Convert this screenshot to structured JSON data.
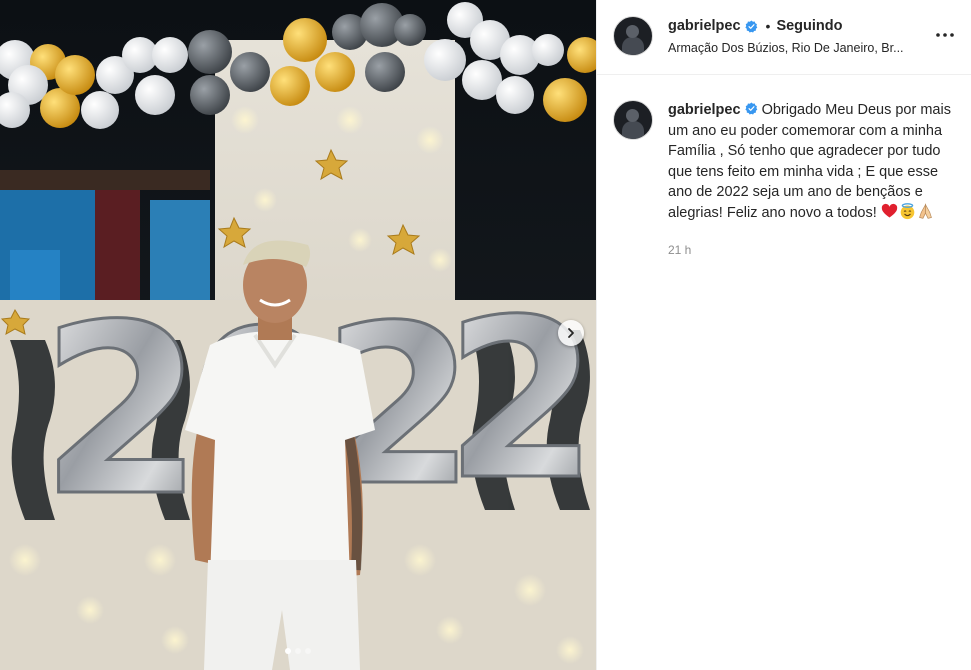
{
  "post": {
    "username": "gabrielpec",
    "follow_separator": "•",
    "follow_status": "Seguindo",
    "location": "Armação Dos Búzios, Rio De Janeiro, Br...",
    "more_icon": "more-horizontal-icon",
    "verified_icon": "verified-badge-icon",
    "verified_color": "#3897f0",
    "caption": "Obrigado Meu Deus por mais um ano eu poder comemorar com a minha Família , Só tenho que agradecer por tudo que tens feito em minha vida ; E que esse ano de 2022 seja um ano de bençãos e alegrias! Feliz ano novo a todos!",
    "caption_emojis": [
      "heart-emoji",
      "smiling-face-with-halo-emoji",
      "folded-hands-emoji"
    ],
    "timestamp": "21 h"
  },
  "photo": {
    "balloon_numbers": "2022",
    "carousel": {
      "next_icon": "chevron-right-icon",
      "total_slides": 3,
      "active_index": 0
    }
  }
}
